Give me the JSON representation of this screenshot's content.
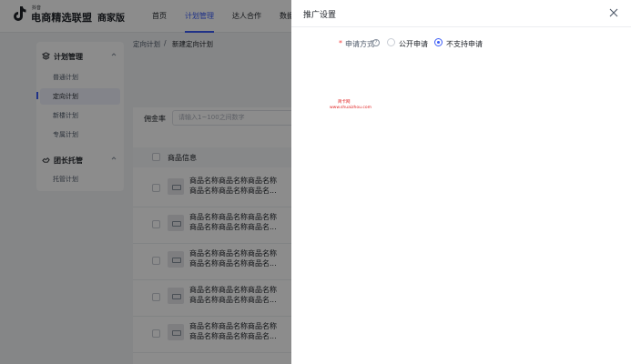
{
  "brand": {
    "small_text": "抖音",
    "name": "电商精选联盟",
    "edition": "商家版"
  },
  "nav": [
    {
      "label": "首页",
      "active": false
    },
    {
      "label": "计划管理",
      "active": true
    },
    {
      "label": "达人合作",
      "active": false
    },
    {
      "label": "数据",
      "active": false
    }
  ],
  "sidebar": {
    "group1": {
      "label": "计划管理",
      "icon": "layers-icon"
    },
    "items1": [
      {
        "label": "普通计划",
        "active": false
      },
      {
        "label": "定向计划",
        "active": true
      },
      {
        "label": "新楼计划",
        "active": false
      },
      {
        "label": "专属计划",
        "active": false
      }
    ],
    "group2": {
      "label": "团长托管",
      "icon": "handshake-icon"
    },
    "items2": [
      {
        "label": "托管计划",
        "active": false
      }
    ]
  },
  "breadcrumb": {
    "parent": "定向计划",
    "separator": "/",
    "current": "新建定向计划"
  },
  "filter": {
    "label": "佣金率",
    "placeholder": "请输入1~100之间数字"
  },
  "table": {
    "header": "商品信息",
    "rows": [
      {
        "line1": "商品名称商品名称商品名称",
        "line2": "商品名称商品名称商品名..."
      },
      {
        "line1": "商品名称商品名称商品名称",
        "line2": "商品名称商品名称商品名..."
      },
      {
        "line1": "商品名称商品名称商品名称",
        "line2": "商品名称商品名称商品名..."
      },
      {
        "line1": "商品名称商品名称商品名称",
        "line2": "商品名称商品名称商品名..."
      },
      {
        "line1": "商品名称商品名称商品名称",
        "line2": "商品名称商品名称商品名..."
      }
    ]
  },
  "drawer": {
    "title": "推广设置",
    "field_label": "申请方式",
    "required_mark": "*",
    "help_glyph": "?",
    "options": [
      {
        "label": "公开申请",
        "checked": false
      },
      {
        "label": "不支持申请",
        "checked": true
      }
    ],
    "watermark_line1": "简卡网",
    "watermark_line2": "www.shuaizhou.com"
  },
  "colors": {
    "accent": "#3b5cf6",
    "required": "#f53f3f",
    "mask": "rgba(0,0,0,0.45)"
  }
}
